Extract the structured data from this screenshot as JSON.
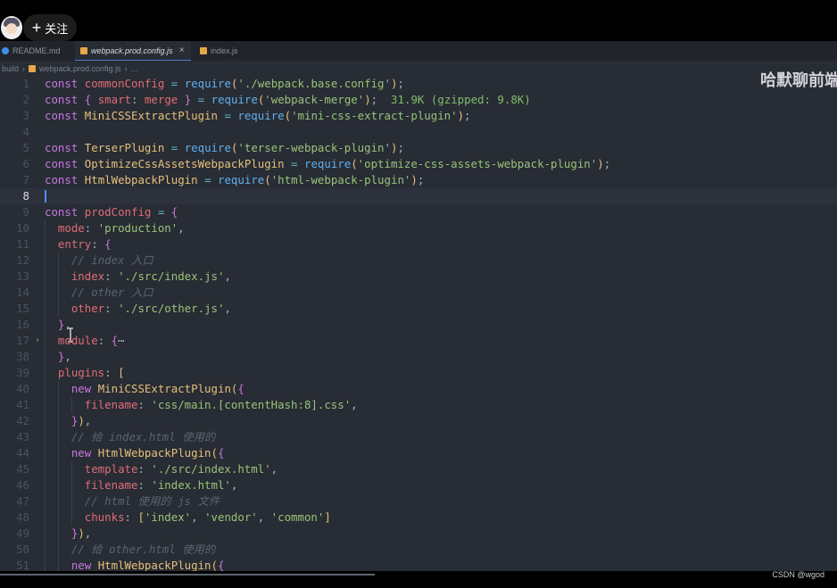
{
  "follow_label": "关注",
  "watermark": "哈默聊前端",
  "tabs": [
    {
      "label": "README.md",
      "icon": "info-icon"
    },
    {
      "label": "webpack.prod.config.js",
      "icon": "js-icon",
      "active": true
    },
    {
      "label": "index.js",
      "icon": "js-icon"
    }
  ],
  "breadcrumb": {
    "folder": "build",
    "file": "webpack.prod.config.js",
    "rest": "..."
  },
  "import_size_hint": "31.9K (gzipped: 9.8K)",
  "code_lines": [
    {
      "n": "1",
      "t": "const commonConfig = require('./webpack.base.config');"
    },
    {
      "n": "2",
      "t": "const { smart: merge } = require('webpack-merge');"
    },
    {
      "n": "3",
      "t": "const MiniCSSExtractPlugin = require('mini-css-extract-plugin');"
    },
    {
      "n": "4",
      "t": ""
    },
    {
      "n": "5",
      "t": "const TerserPlugin = require('terser-webpack-plugin');"
    },
    {
      "n": "6",
      "t": "const OptimizeCssAssetsWebpackPlugin = require('optimize-css-assets-webpack-plugin');"
    },
    {
      "n": "7",
      "t": "const HtmlWebpackPlugin = require('html-webpack-plugin');"
    },
    {
      "n": "8",
      "t": ""
    },
    {
      "n": "9",
      "t": "const prodConfig = {"
    },
    {
      "n": "10",
      "t": "  mode: 'production',"
    },
    {
      "n": "11",
      "t": "  entry: {"
    },
    {
      "n": "12",
      "t": "    // index 入口"
    },
    {
      "n": "13",
      "t": "    index: './src/index.js',"
    },
    {
      "n": "14",
      "t": "    // other 入口"
    },
    {
      "n": "15",
      "t": "    other: './src/other.js',"
    },
    {
      "n": "16",
      "t": "  },"
    },
    {
      "n": "17",
      "t": "  module: {⋯"
    },
    {
      "n": "38",
      "t": "  },"
    },
    {
      "n": "39",
      "t": "  plugins: ["
    },
    {
      "n": "40",
      "t": "    new MiniCSSExtractPlugin({"
    },
    {
      "n": "41",
      "t": "      filename: 'css/main.[contentHash:8].css',"
    },
    {
      "n": "42",
      "t": "    }),"
    },
    {
      "n": "43",
      "t": "    // 给 index.html 使用的"
    },
    {
      "n": "44",
      "t": "    new HtmlWebpackPlugin({"
    },
    {
      "n": "45",
      "t": "      template: './src/index.html',"
    },
    {
      "n": "46",
      "t": "      filename: 'index.html',"
    },
    {
      "n": "47",
      "t": "      // html 使用的 js 文件"
    },
    {
      "n": "48",
      "t": "      chunks: ['index', 'vendor', 'common']"
    },
    {
      "n": "49",
      "t": "    }),"
    },
    {
      "n": "50",
      "t": "    // 给 other.html 使用的"
    },
    {
      "n": "51",
      "t": "    new HtmlWebpackPlugin({"
    }
  ],
  "current_line": "8",
  "status_right": "CSDN @wgod"
}
